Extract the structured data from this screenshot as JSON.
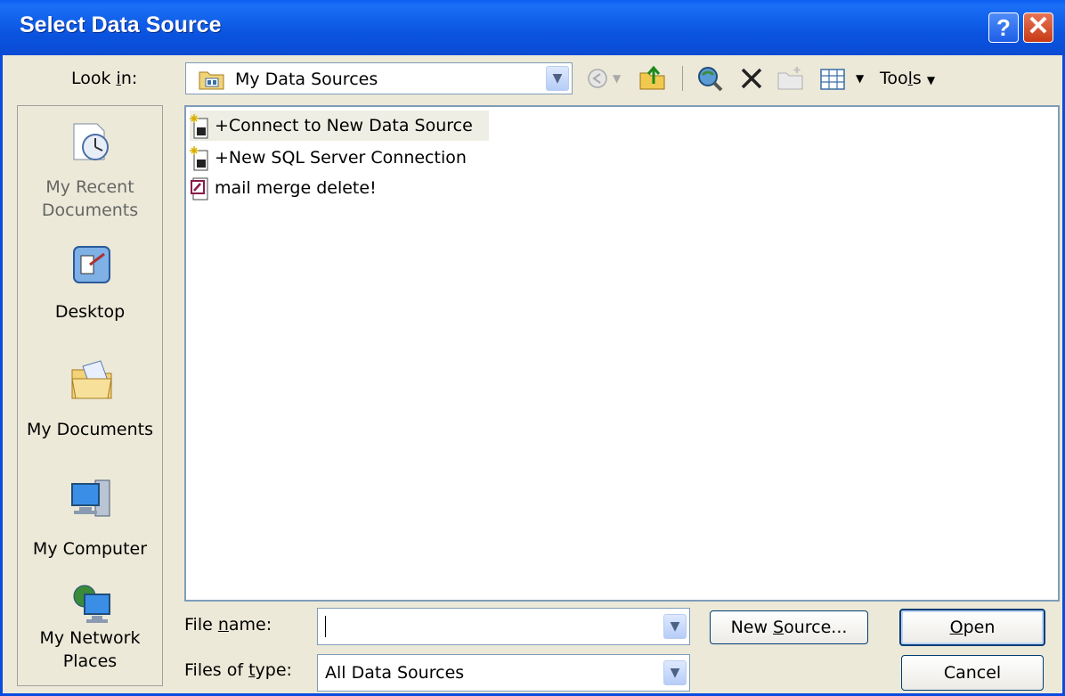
{
  "window": {
    "title": "Select Data Source",
    "help_glyph": "?",
    "close_glyph": "✕"
  },
  "lookin": {
    "label": "Look in:",
    "value": "My Data Sources",
    "tools_label": "Tools",
    "toolbar_icons": [
      "back-icon",
      "up-folder-icon",
      "search-web-icon",
      "delete-icon",
      "new-folder-icon",
      "views-icon"
    ]
  },
  "places": [
    {
      "label": "My Recent Documents",
      "icon": "recent-documents-icon"
    },
    {
      "label": "Desktop",
      "icon": "desktop-icon"
    },
    {
      "label": "My Documents",
      "icon": "my-documents-icon"
    },
    {
      "label": "My Computer",
      "icon": "my-computer-icon"
    },
    {
      "label": "My Network Places",
      "icon": "network-places-icon"
    }
  ],
  "files": [
    {
      "label": "+Connect to New Data Source",
      "icon": "new-connection-icon",
      "selected": true
    },
    {
      "label": "+New SQL Server Connection",
      "icon": "new-connection-icon",
      "selected": false
    },
    {
      "label": "mail merge delete!",
      "icon": "access-database-icon",
      "selected": false
    }
  ],
  "filename": {
    "label": "File name:",
    "value": ""
  },
  "filetype": {
    "label": "Files of type:",
    "value": "All Data Sources"
  },
  "buttons": {
    "new_source": "New Source...",
    "open": "Open",
    "cancel": "Cancel"
  },
  "colors": {
    "titlebar": "#0a54e0",
    "client": "#ece9d8",
    "close_button": "#c83a15"
  }
}
